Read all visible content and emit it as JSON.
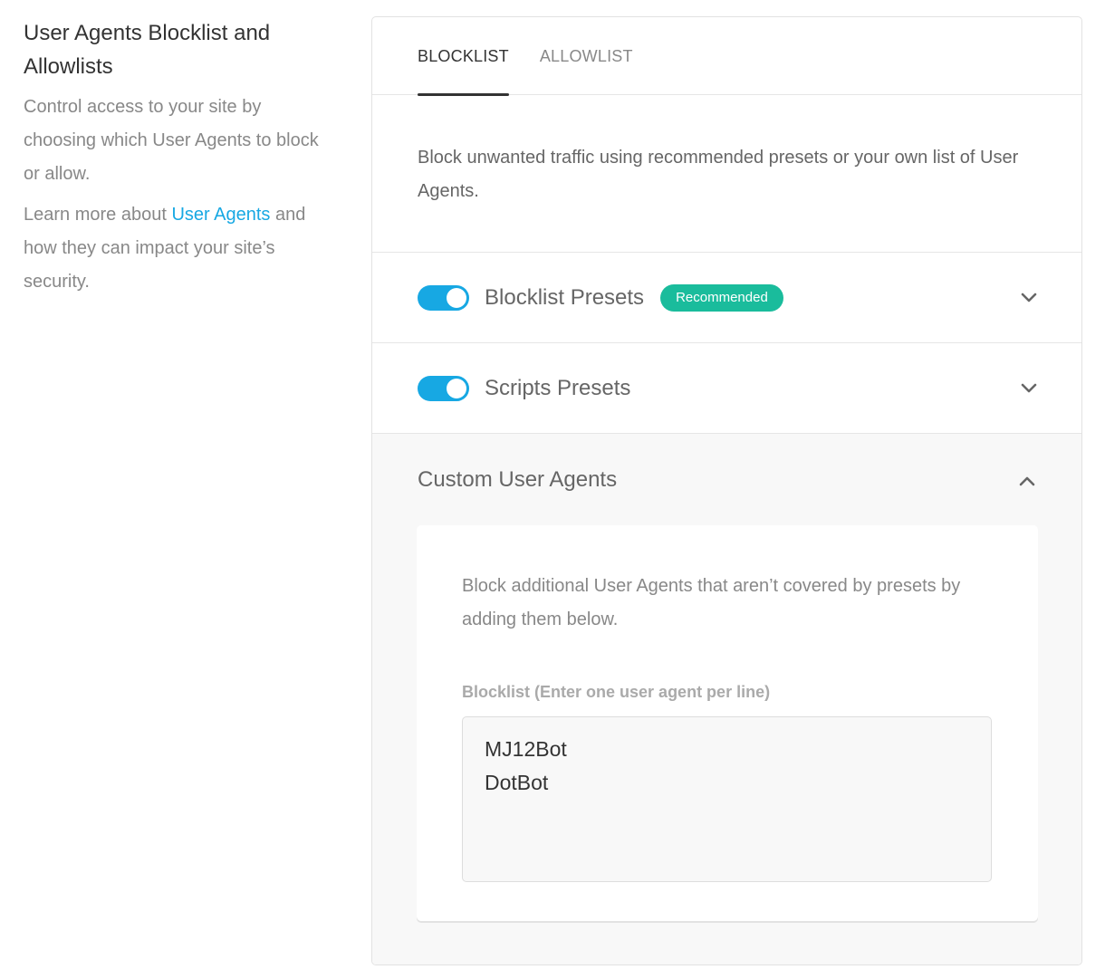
{
  "left": {
    "title": "User Agents Blocklist and Allowlists",
    "description": "Control access to your site by choosing which User Agents to block or allow.",
    "learn_prefix": "Learn more about ",
    "learn_link": "User Agents",
    "learn_suffix": " and how they can impact your site’s security."
  },
  "tabs": [
    {
      "label": "BLOCKLIST",
      "active": true
    },
    {
      "label": "ALLOWLIST",
      "active": false
    }
  ],
  "intro": "Block unwanted traffic using recommended presets or your own list of User Agents.",
  "presets": [
    {
      "label": "Blocklist Presets",
      "enabled": true,
      "badge": "Recommended",
      "chevron": "chevron-down-icon"
    },
    {
      "label": "Scripts Presets",
      "enabled": true,
      "chevron": "chevron-down-icon"
    }
  ],
  "custom": {
    "title": "Custom User Agents",
    "chevron": "chevron-up-icon",
    "description": "Block additional User Agents that aren’t covered by presets by adding them below.",
    "field_label": "Blocklist (Enter one user agent per line)",
    "entries": [
      "MJ12Bot",
      "DotBot"
    ]
  },
  "colors": {
    "accent": "#17a8e3",
    "badge": "#1abc9c",
    "muted_text": "#888888"
  }
}
